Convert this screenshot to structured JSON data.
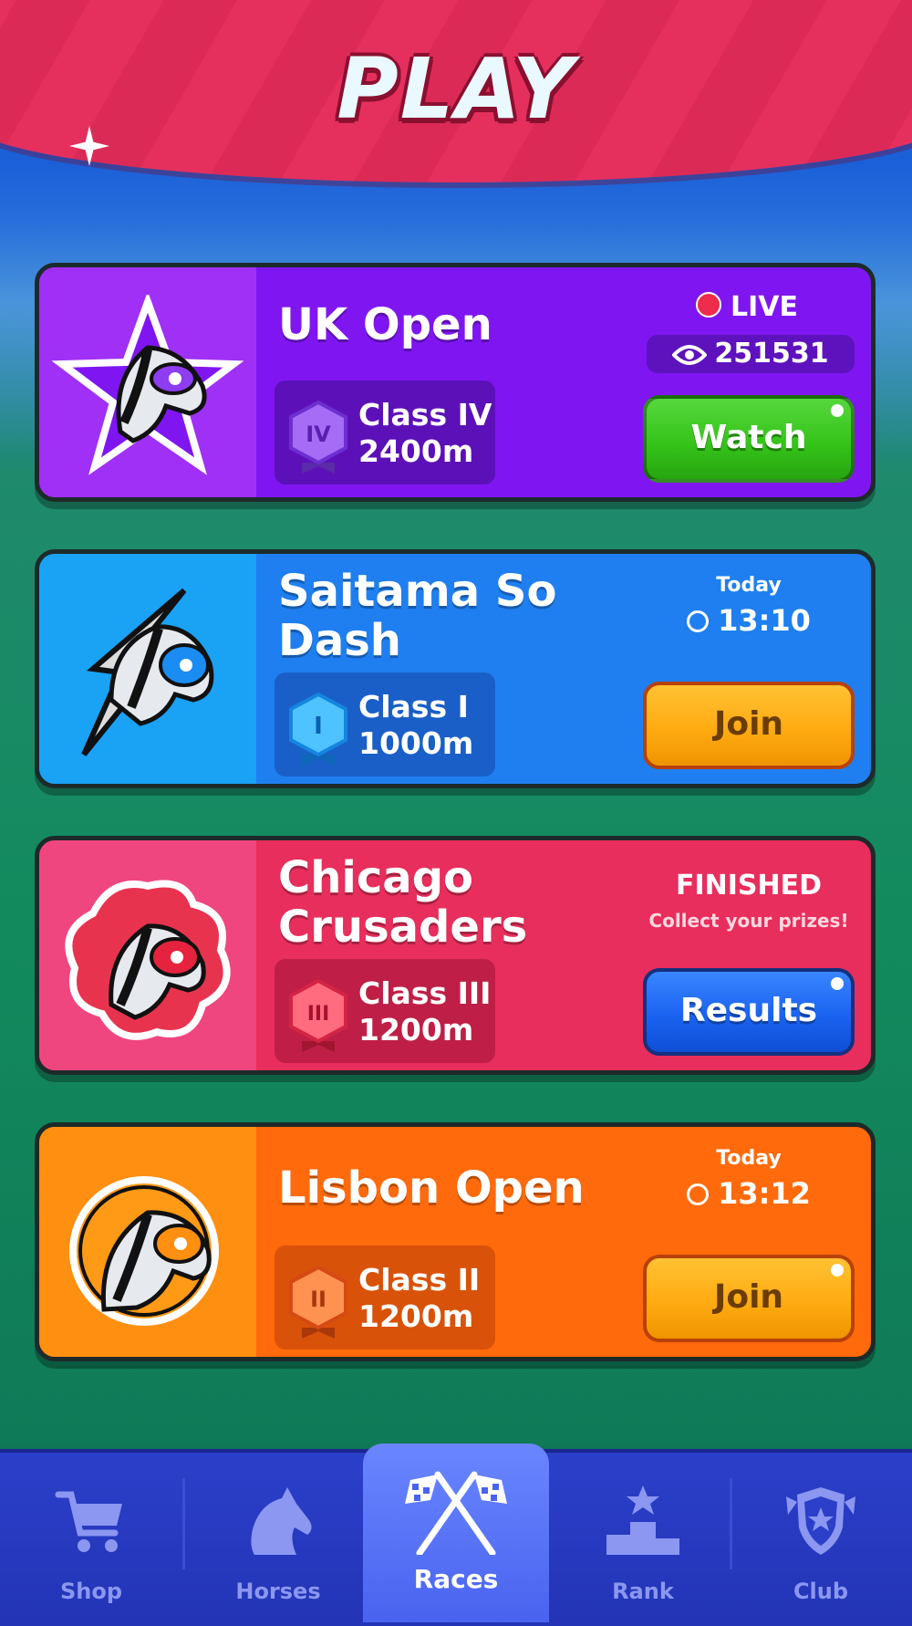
{
  "header": {
    "title": "PLAY"
  },
  "races": [
    {
      "name": "UK Open",
      "class_label": "Class IV",
      "class_numeral": "IV",
      "distance": "2400m",
      "status": "LIVE",
      "viewers": "251531",
      "button": "Watch"
    },
    {
      "name": "Saitama So Dash",
      "class_label": "Class I",
      "class_numeral": "I",
      "distance": "1000m",
      "day": "Today",
      "time": "13:10",
      "button": "Join"
    },
    {
      "name": "Chicago Crusaders",
      "class_label": "Class III",
      "class_numeral": "III",
      "distance": "1200m",
      "status": "FINISHED",
      "status_sub": "Collect your prizes!",
      "button": "Results"
    },
    {
      "name": "Lisbon Open",
      "class_label": "Class II",
      "class_numeral": "II",
      "distance": "1200m",
      "day": "Today",
      "time": "13:12",
      "button": "Join"
    }
  ],
  "nav": [
    {
      "label": "Shop",
      "icon": "cart-icon"
    },
    {
      "label": "Horses",
      "icon": "horse-head-icon"
    },
    {
      "label": "Races",
      "icon": "crossed-flags-icon",
      "active": true
    },
    {
      "label": "Rank",
      "icon": "podium-icon"
    },
    {
      "label": "Club",
      "icon": "shield-icon"
    }
  ],
  "colors": {
    "header": "#e5305e",
    "uk_open": "#7f16f2",
    "saitama": "#1f7ff0",
    "chicago": "#e82e5c",
    "lisbon": "#ff6a0c",
    "watch_button": "#36c41a",
    "join_button": "#ffab12",
    "results_button": "#1a62f0",
    "nav_bar": "#2b3fc9",
    "nav_active": "#4a63ef"
  }
}
